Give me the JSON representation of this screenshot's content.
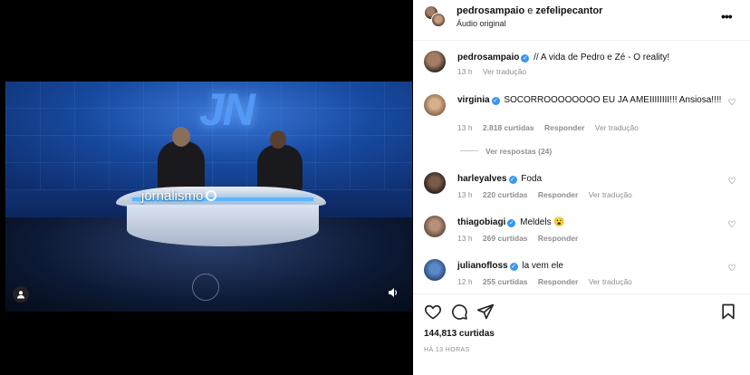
{
  "video": {
    "studio_logo": "JN",
    "desk_brand": "jornalismo"
  },
  "header": {
    "user1": "pedrosampaio",
    "connector": " e ",
    "user2": "zefelipecantor",
    "audio": "Áudio original",
    "more": "•••"
  },
  "caption": {
    "user": "pedrosampaio",
    "text": "// A vida de Pedro e Zé - O reality!",
    "time": "13 h",
    "translate": "Ver tradução"
  },
  "comments": [
    {
      "user": "virginia",
      "text": "SOCORROOOOOOOO EU JA AMEIIIIIIII!!! Ansiosa!!!!",
      "time": "13 h",
      "likes": "2.818 curtidas",
      "reply": "Responder",
      "translate": "Ver tradução",
      "replies": "Ver respostas (24)"
    },
    {
      "user": "harleyalves",
      "text": "Foda",
      "time": "13 h",
      "likes": "220 curtidas",
      "reply": "Responder",
      "translate": "Ver tradução"
    },
    {
      "user": "thiagobiagi",
      "text": "Meldels 😮",
      "time": "13 h",
      "likes": "269 curtidas",
      "reply": "Responder"
    },
    {
      "user": "julianofloss",
      "text": "la vem ele",
      "time": "12 h",
      "likes": "255 curtidas",
      "reply": "Responder",
      "translate": "Ver tradução"
    }
  ],
  "footer": {
    "likes": "144,813 curtidas",
    "time_ago": "HÁ 13 HORAS"
  },
  "icons": {
    "like": "heart-icon",
    "comment": "comment-icon",
    "share": "share-icon",
    "save": "bookmark-icon",
    "user_tag": "user-tag-icon",
    "volume": "volume-icon"
  },
  "colors": {
    "verified": "#3897f0",
    "muted_text": "#8e8e8e"
  }
}
